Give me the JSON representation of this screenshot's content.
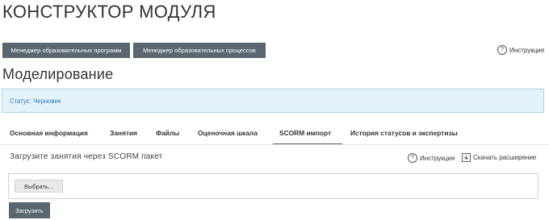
{
  "page": {
    "title": "КОНСТРУКТОР МОДУЛЯ"
  },
  "header_buttons": {
    "programs_manager": "Менеджер образовательных программ",
    "processes_manager": "Менеджер образовательных процессов"
  },
  "top_help": {
    "label": "Инструкция",
    "icon": "question-circle-icon"
  },
  "section": {
    "title": "Моделирование"
  },
  "status": {
    "text": "Статус: Черновик"
  },
  "tabs": [
    {
      "label": "Основная информация",
      "active": false
    },
    {
      "label": "Занятия",
      "active": false
    },
    {
      "label": "Файлы",
      "active": false
    },
    {
      "label": "Оценочная шкала",
      "active": false
    },
    {
      "label": "SCORM импорт",
      "active": true
    },
    {
      "label": "История статусов и экспертизы",
      "active": false
    }
  ],
  "scorm": {
    "heading": "Загрузите занятия через SCORM пакет",
    "help_label": "Инструкция",
    "download_label": "Скачать расширение",
    "choose_label": "Выбрать...",
    "upload_label": "Загрузить"
  },
  "colors": {
    "dark_button": "#5b6770",
    "status_bg": "#e4f2fa",
    "status_border": "#acd5ea",
    "status_text": "#2b7bb1"
  }
}
